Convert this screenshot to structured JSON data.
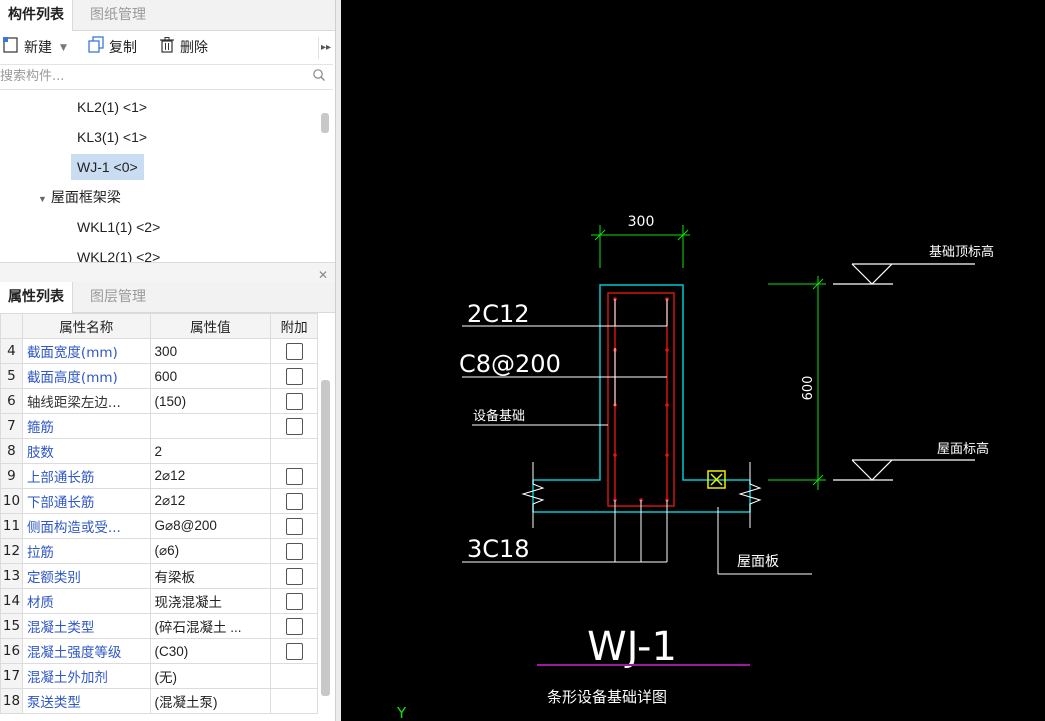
{
  "top_tabs": [
    {
      "label": "构件列表",
      "active": true
    },
    {
      "label": "图纸管理",
      "active": false
    }
  ],
  "toolbar": {
    "new_label": "新建",
    "copy_label": "复制",
    "delete_label": "删除"
  },
  "search": {
    "placeholder": "搜索构件..."
  },
  "tree": {
    "items": [
      "KL2(1) <1>",
      "KL3(1) <1>",
      "WJ-1 <0>"
    ],
    "group": "屋面框架梁",
    "group_items": [
      "WKL1(1) <2>",
      "WKL2(1) <2>"
    ]
  },
  "bottom_tabs": [
    {
      "label": "属性列表",
      "active": true
    },
    {
      "label": "图层管理",
      "active": false
    }
  ],
  "props": {
    "headers": [
      "属性名称",
      "属性值",
      "附加"
    ],
    "rows": [
      {
        "num": "4",
        "name": "截面宽度(mm)",
        "value": "300",
        "blue": true,
        "checkbox": true
      },
      {
        "num": "5",
        "name": "截面高度(mm)",
        "value": "600",
        "blue": true,
        "checkbox": true
      },
      {
        "num": "6",
        "name": "轴线距梁左边...",
        "value": "(150)",
        "blue": false,
        "checkbox": true
      },
      {
        "num": "7",
        "name": "箍筋",
        "value": "",
        "blue": true,
        "checkbox": true
      },
      {
        "num": "8",
        "name": "肢数",
        "value": "2",
        "blue": true,
        "checkbox": false
      },
      {
        "num": "9",
        "name": "上部通长筋",
        "value": "2⌀12",
        "blue": true,
        "checkbox": true
      },
      {
        "num": "10",
        "name": "下部通长筋",
        "value": "2⌀12",
        "blue": true,
        "checkbox": true
      },
      {
        "num": "11",
        "name": "侧面构造或受...",
        "value": "G⌀8@200",
        "blue": true,
        "checkbox": true
      },
      {
        "num": "12",
        "name": "拉筋",
        "value": "(⌀6)",
        "blue": true,
        "checkbox": true
      },
      {
        "num": "13",
        "name": "定额类别",
        "value": "有梁板",
        "blue": true,
        "checkbox": true
      },
      {
        "num": "14",
        "name": "材质",
        "value": "现浇混凝土",
        "blue": true,
        "checkbox": true
      },
      {
        "num": "15",
        "name": "混凝土类型",
        "value": "(碎石混凝土 ...",
        "blue": true,
        "checkbox": true
      },
      {
        "num": "16",
        "name": "混凝土强度等级",
        "value": "(C30)",
        "blue": true,
        "checkbox": true
      },
      {
        "num": "17",
        "name": "混凝土外加剂",
        "value": "(无)",
        "blue": true,
        "checkbox": false
      },
      {
        "num": "18",
        "name": "泵送类型",
        "value": "(混凝土泵)",
        "blue": true,
        "checkbox": false
      }
    ]
  },
  "drawing": {
    "dim_width": "300",
    "dim_height": "600",
    "label_top_bars": "2C12",
    "label_stirrup": "C8@200",
    "label_equipment": "设备基础",
    "label_bottom_bars": "3C18",
    "label_roof_slab": "屋面板",
    "label_found_top": "基础顶标高",
    "label_roof_elev": "屋面标高",
    "title": "WJ-1",
    "subtitle": "条形设备基础详图",
    "axis_y": "Y",
    "colors": {
      "concrete": "#00c8d2",
      "rebar": "#e01515",
      "dim": "#10e010",
      "text": "#ffffff",
      "title_line": "#9a1aa0",
      "marker": "#f0f000"
    }
  }
}
